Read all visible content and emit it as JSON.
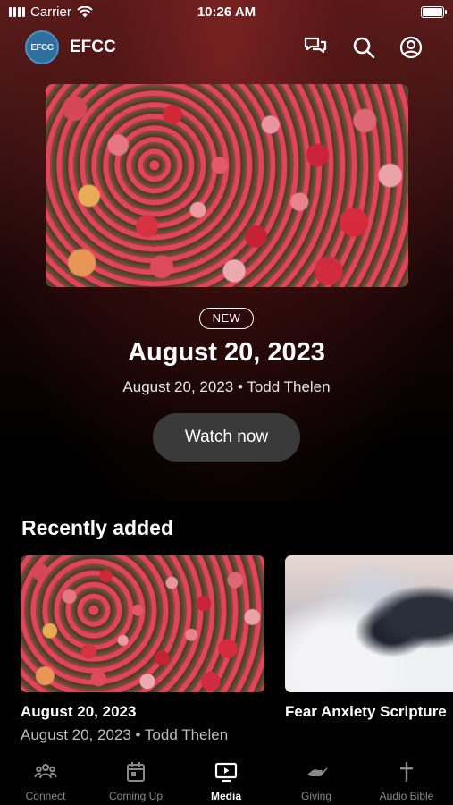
{
  "status_bar": {
    "carrier": "Carrier",
    "time": "10:26 AM"
  },
  "header": {
    "logo_text": "EFCC",
    "org_name": "EFCC",
    "icons": [
      "chat-icon",
      "search-icon",
      "profile-icon"
    ]
  },
  "hero": {
    "badge": "NEW",
    "title": "August 20, 2023",
    "subtitle": "August 20, 2023 • Todd Thelen",
    "watch_label": "Watch now"
  },
  "recently_added": {
    "heading": "Recently added",
    "items": [
      {
        "title": "August 20, 2023",
        "meta": "August 20, 2023 • Todd Thelen"
      },
      {
        "title": "Fear Anxiety Scripture",
        "meta": ""
      }
    ]
  },
  "tabs": [
    {
      "label": "Connect",
      "icon": "people-icon",
      "active": false
    },
    {
      "label": "Coming Up",
      "icon": "calendar-icon",
      "active": false
    },
    {
      "label": "Media",
      "icon": "tv-play-icon",
      "active": true
    },
    {
      "label": "Giving",
      "icon": "hand-icon",
      "active": false
    },
    {
      "label": "Audio Bible",
      "icon": "cross-icon",
      "active": false
    }
  ],
  "colors": {
    "accent_bg": "#5a1c1c",
    "button_bg": "#3a3a3a",
    "inactive_tab": "#8a8a8a"
  }
}
